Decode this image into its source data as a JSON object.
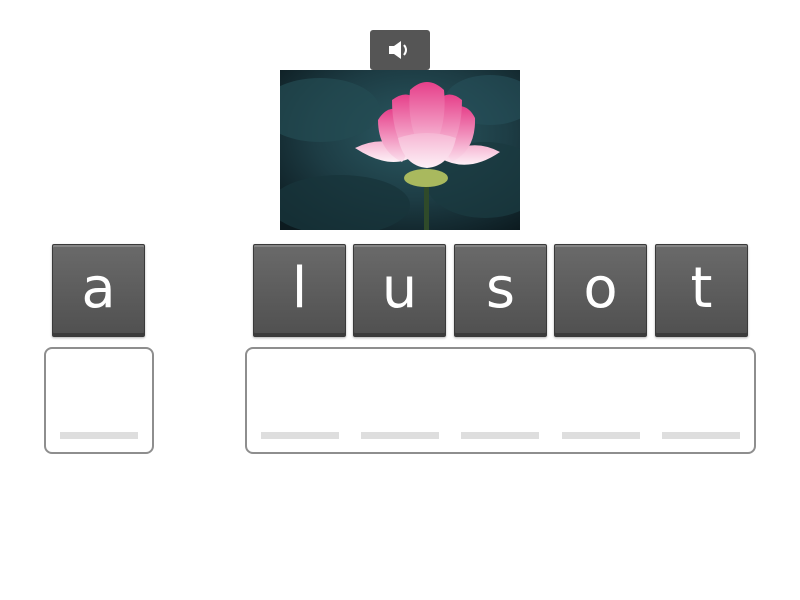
{
  "audio_button": {
    "icon": "speaker-icon"
  },
  "picture": {
    "subject": "lotus-flower"
  },
  "tiles": [
    "a",
    "l",
    "u",
    "s",
    "o",
    "t"
  ],
  "colors": {
    "tile": "#5a5a5a",
    "tile_text": "#ffffff",
    "slot_border": "#8e8e8e",
    "slot_line": "#dedede"
  }
}
